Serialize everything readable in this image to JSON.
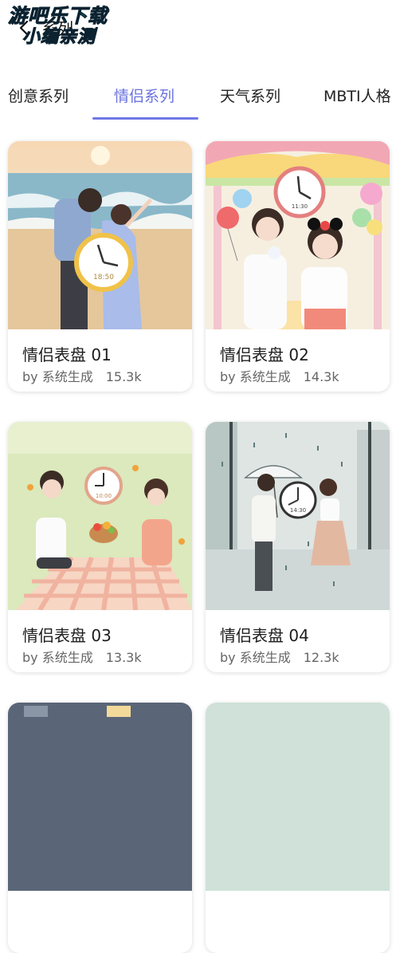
{
  "header": {
    "title": "系列",
    "back_icon": "chevron-left-icon"
  },
  "watermark": {
    "line1": "游吧乐下载",
    "line2": "小编亲测"
  },
  "tabs": [
    {
      "label": "创意系列",
      "active": false
    },
    {
      "label": "情侣系列",
      "active": true
    },
    {
      "label": "天气系列",
      "active": false
    },
    {
      "label": "MBTI人格",
      "active": false
    }
  ],
  "colors": {
    "accent": "#6f78e6",
    "watermark": "#1ec7ea"
  },
  "cards": [
    {
      "title": "情侣表盘 01",
      "author": "by 系统生成",
      "likes": "15.3k",
      "clock_text": "18:50",
      "scene": "beach"
    },
    {
      "title": "情侣表盘 02",
      "author": "by 系统生成",
      "likes": "14.3k",
      "clock_text": "11:30",
      "scene": "carousel"
    },
    {
      "title": "情侣表盘 03",
      "author": "by 系统生成",
      "likes": "13.3k",
      "clock_text": "10:00",
      "scene": "picnic"
    },
    {
      "title": "情侣表盘 04",
      "author": "by 系统生成",
      "likes": "12.3k",
      "clock_text": "14:30",
      "scene": "rain"
    }
  ]
}
